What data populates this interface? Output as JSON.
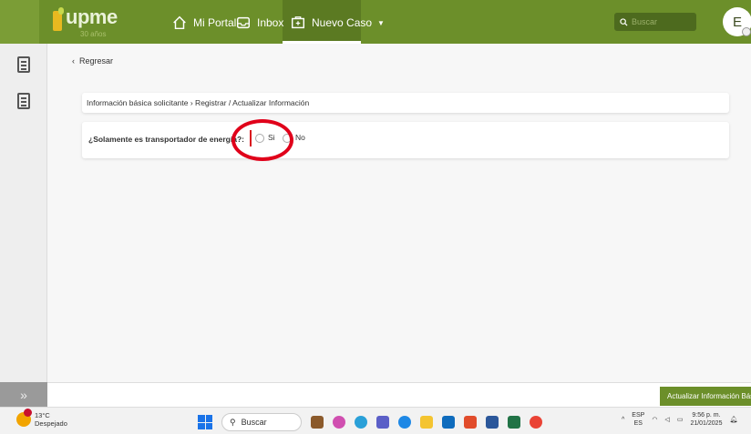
{
  "topbar": {
    "logo_text": "upme",
    "logo_sub": "30 años",
    "nav": [
      {
        "label": "Mi Portal",
        "icon": "home-icon"
      },
      {
        "label": "Inbox",
        "icon": "inbox-icon"
      },
      {
        "label": "Nuevo Caso",
        "icon": "new-case-icon",
        "active": true
      }
    ],
    "search_placeholder": "Buscar",
    "avatar_initial": "E"
  },
  "main": {
    "back_label": "Regresar",
    "breadcrumb": "Información básica solicitante › Registrar / Actualizar Información",
    "question": "¿Solamente es transportador de energía?:",
    "options": [
      "Si",
      "No"
    ]
  },
  "footer": {
    "collapse_icon": "»",
    "update_button": "Actualizar Información Básica"
  },
  "taskbar": {
    "temperature": "13°C",
    "weather": "Despejado",
    "search_label": "Buscar",
    "lang_top": "ESP",
    "lang_bottom": "ES",
    "time": "9:56 p. m.",
    "date": "21/01/2025"
  },
  "colors": {
    "brand_green": "#6c8f2a",
    "required_red": "#d9141e",
    "annotation_red": "#e0001a"
  }
}
